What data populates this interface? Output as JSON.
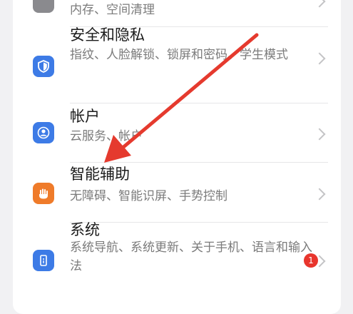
{
  "settings": {
    "storage": {
      "subtitle": "内存、空间清理"
    },
    "security": {
      "title": "安全和隐私",
      "subtitle": "指纹、人脸解锁、锁屏和密码、学生模式",
      "icon": "shield-icon",
      "icon_color": "#3d7be6"
    },
    "accounts": {
      "title": "帐户",
      "subtitle": "云服务、帐户",
      "icon": "user-icon",
      "icon_color": "#3d7be6"
    },
    "accessibility": {
      "title": "智能辅助",
      "subtitle": "无障碍、智能识屏、手势控制",
      "icon": "hand-icon",
      "icon_color": "#ef7b2a"
    },
    "system": {
      "title": "系统",
      "subtitle": "系统导航、系统更新、关于手机、语言和输入法",
      "icon": "phone-icon",
      "icon_color": "#3d7be6",
      "badge": "1",
      "badge_color": "#e8352d"
    }
  },
  "annotation": {
    "arrow_color": "#e53a2e"
  }
}
